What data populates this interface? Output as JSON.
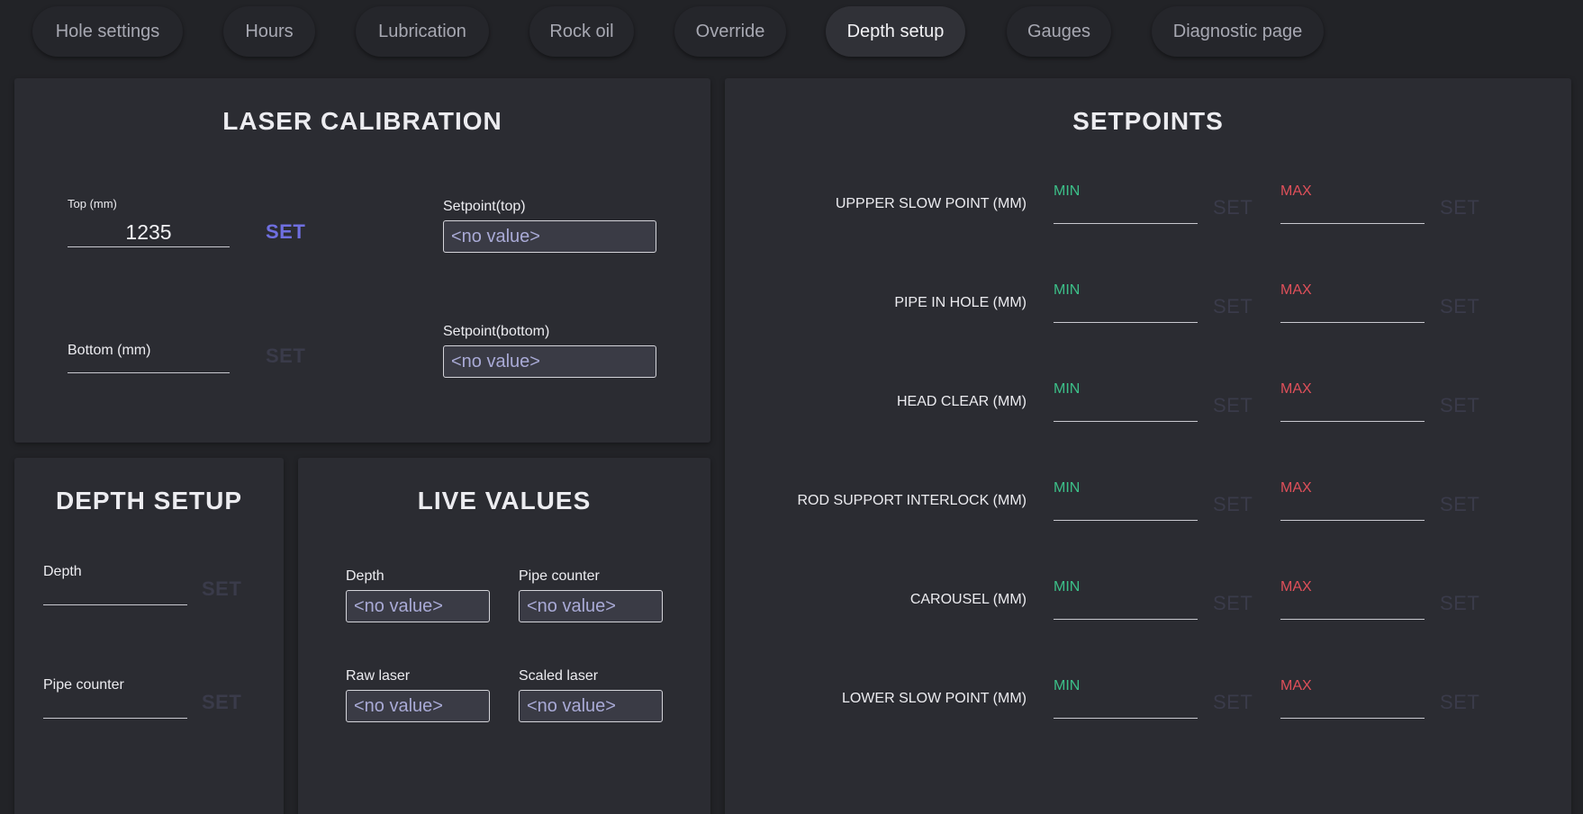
{
  "tabs": [
    {
      "label": "Hole settings",
      "active": false
    },
    {
      "label": "Hours",
      "active": false
    },
    {
      "label": "Lubrication",
      "active": false
    },
    {
      "label": "Rock oil",
      "active": false
    },
    {
      "label": "Override",
      "active": false
    },
    {
      "label": "Depth setup",
      "active": true
    },
    {
      "label": "Gauges",
      "active": false
    },
    {
      "label": "Diagnostic page",
      "active": false
    }
  ],
  "laser_calibration": {
    "title": "LASER CALIBRATION",
    "top_label": "Top (mm)",
    "top_value": "1235",
    "top_set": "SET",
    "bottom_label": "Bottom (mm)",
    "bottom_value": "",
    "bottom_set": "SET",
    "setpoint_top_label": "Setpoint(top)",
    "setpoint_top_value": "<no value>",
    "setpoint_bottom_label": "Setpoint(bottom)",
    "setpoint_bottom_value": "<no value>"
  },
  "depth_setup": {
    "title": "DEPTH SETUP",
    "depth_label": "Depth",
    "depth_set": "SET",
    "pipe_counter_label": "Pipe counter",
    "pipe_counter_set": "SET"
  },
  "live_values": {
    "title": "LIVE VALUES",
    "depth_label": "Depth",
    "depth_value": "<no value>",
    "pipe_counter_label": "Pipe counter",
    "pipe_counter_value": "<no value>",
    "raw_laser_label": "Raw laser",
    "raw_laser_value": "<no value>",
    "scaled_laser_label": "Scaled laser",
    "scaled_laser_value": "<no value>"
  },
  "setpoints": {
    "title": "SETPOINTS",
    "min_label": "MIN",
    "max_label": "MAX",
    "set_label": "SET",
    "rows": [
      {
        "label": "UPPPER SLOW POINT (MM)"
      },
      {
        "label": "PIPE IN HOLE (MM)"
      },
      {
        "label": "HEAD CLEAR (MM)"
      },
      {
        "label": "ROD SUPPORT INTERLOCK (MM)"
      },
      {
        "label": "CAROUSEL (MM)"
      },
      {
        "label": "LOWER SLOW POINT (MM)"
      }
    ]
  },
  "colors": {
    "background": "#222327",
    "panel": "#2b2c32",
    "accent_set": "#6f6fe0",
    "min": "#3cc089",
    "max": "#e0505a"
  }
}
